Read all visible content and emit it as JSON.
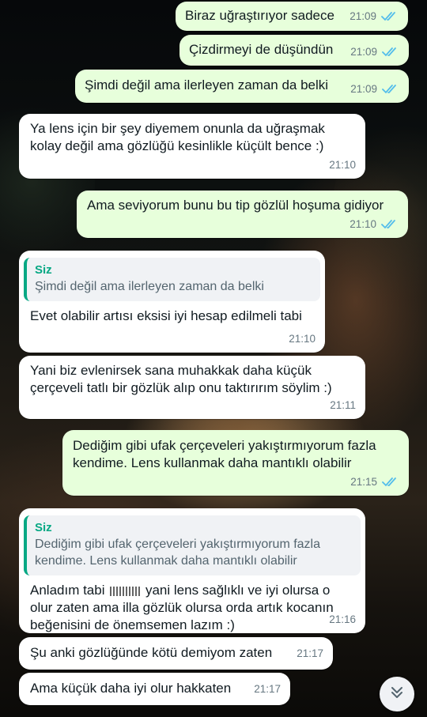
{
  "colors": {
    "outgoing": "#e7ffdb",
    "incoming": "#ffffff",
    "read_ticks": "#53bdeb",
    "quote_accent": "#06a884"
  },
  "messages": [
    {
      "dir": "out",
      "text": "Biraz uğraştırıyor sadece",
      "time": "21:09",
      "status": "read"
    },
    {
      "dir": "out",
      "text": "Çizdirmeyi de düşündün",
      "time": "21:09",
      "status": "read"
    },
    {
      "dir": "out",
      "text": "Şimdi değil ama ilerleyen zaman da belki",
      "time": "21:09",
      "status": "read"
    },
    {
      "dir": "in",
      "text": "Ya lens için bir şey diyemem onunla da uğraşmak\nkolay değil ama gözlüğü kesinlikle küçült bence :)",
      "time": "21:10"
    },
    {
      "dir": "out",
      "text": "Ama seviyorum bunu bu tip gözlül hoşuma gidiyor",
      "time": "21:10",
      "status": "read"
    },
    {
      "dir": "in",
      "quote_author": "Siz",
      "quote_text": "Şimdi değil ama ilerleyen zaman da belki",
      "text": "Evet olabilir artısı eksisi iyi hesap edilmeli tabi",
      "time": "21:10"
    },
    {
      "dir": "in",
      "text": "Yani biz evlenirsek sana muhakkak daha küçük\nçerçeveli tatlı bir gözlük alıp onu taktırırım söylim :)",
      "time": "21:11"
    },
    {
      "dir": "out",
      "text": "Dediğim gibi ufak çerçeveleri yakıştırmıyorum fazla\nkendime. Lens kullanmak daha mantıklı olabilir",
      "time": "21:15",
      "status": "read"
    },
    {
      "dir": "in",
      "quote_author": "Siz",
      "quote_text": "Dediğim gibi ufak çerçeveleri yakıştırmıyorum fazla\nkendime. Lens kullanmak daha mantıklı olabilir",
      "text_before": "Anladım tabi",
      "text": "yani lens sağlıklı ve iyi olursa o\nolur zaten ama illa gözlük olursa orda artık kocanın\nbeğenisini de önemsemen lazım :)",
      "time": "21:16"
    },
    {
      "dir": "in",
      "text": "Şu anki gözlüğünde kötü demiyom zaten",
      "time": "21:17"
    },
    {
      "dir": "in",
      "text": "Ama küçük daha iyi olur hakkaten",
      "time": "21:17"
    }
  ],
  "scroll_button_icon": "double-chevron-down-icon"
}
